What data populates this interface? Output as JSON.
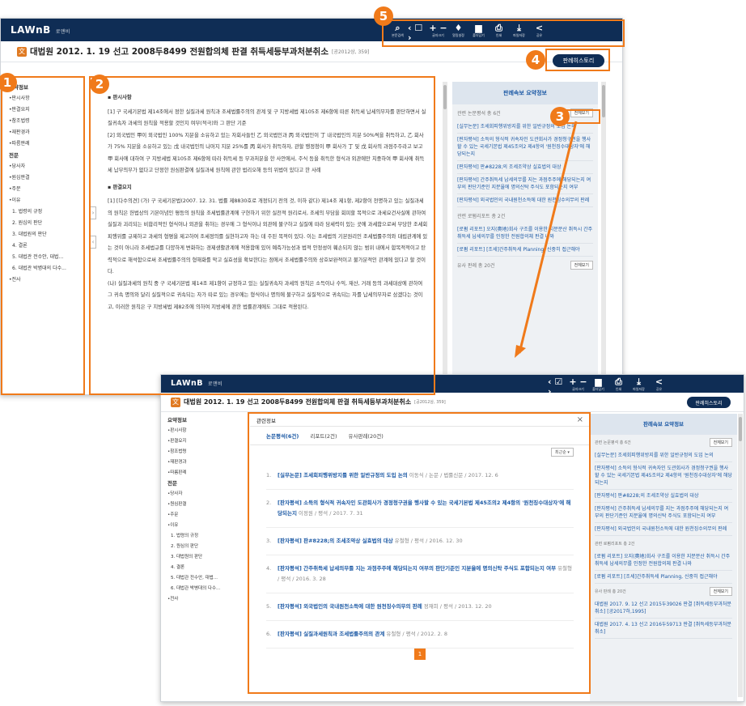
{
  "app": {
    "brand": "LAWnB",
    "user": "로앤비"
  },
  "title": {
    "main": "대법원 2012. 1. 19 선고 2008두8499 전원합의체 판결 취득세등부과처분취소",
    "citation": "[공2012상, 359]"
  },
  "history_button": "판례히스토리",
  "toolbar1": [
    {
      "icon": "search-icon",
      "glyph": "⌕",
      "label": "본문검색"
    },
    {
      "icon": "nav-arrows-icon",
      "glyph": "‹ ☐ ›",
      "label": "검색어"
    },
    {
      "icon": "zoom-icon",
      "glyph": "+ −",
      "label": "글자크기"
    },
    {
      "icon": "bell-icon",
      "glyph": "♦",
      "label": "알림설정"
    },
    {
      "icon": "folder-icon",
      "glyph": "▆",
      "label": "폴더담기"
    },
    {
      "icon": "print-icon",
      "glyph": "⎙",
      "label": "인쇄"
    },
    {
      "icon": "download-icon",
      "glyph": "⤓",
      "label": "파일저장"
    },
    {
      "icon": "share-icon",
      "glyph": "<",
      "label": "공유"
    }
  ],
  "toolbar2": [
    {
      "icon": "nav-arrows-icon",
      "glyph": "‹ ☑ ›",
      "label": "검색어"
    },
    {
      "icon": "zoom-icon",
      "glyph": "+ −",
      "label": "글자크기"
    },
    {
      "icon": "folder-icon",
      "glyph": "▆",
      "label": "폴더담기"
    },
    {
      "icon": "print-icon",
      "glyph": "⎙",
      "label": "인쇄"
    },
    {
      "icon": "download-icon",
      "glyph": "⤓",
      "label": "파일저장"
    },
    {
      "icon": "share-icon",
      "glyph": "<",
      "label": "공유"
    }
  ],
  "toc": {
    "summary_heading": "요약정보",
    "summary": [
      "•판시사항",
      "•판결요지",
      "•참조법령",
      "•재판경과",
      "•따름판례"
    ],
    "full_heading": "전문",
    "full": [
      "•당사자",
      "•원심판결",
      "•주문",
      "•이유"
    ],
    "reasons": [
      "1. 법령의 규정",
      "2. 원심의 판단",
      "3. 대법원의 판단",
      "4. 결론",
      "5. 대법관 전수안, 대법...",
      "6. 대법관 박병대의 다수..."
    ],
    "last": "•전사"
  },
  "content": {
    "sec1": "판시사항",
    "p1": "[1] 구 국세기본법 제14조에서 정한 실질과세 원칙과 조세법률주의의 관계 및 구 지방세법 제105조 제6항에 따른 취득세 납세의무자를 판단하면서 실질귀속자 과세의 원칙을 적용할 것인지 여부(적극)와 그 판단 기준",
    "p2": "[2] 외국법인 甲이 외국법인 100% 지분을 소유하고 있는 자회사들인 乙 외국법인과 丙 외국법인이 丁 내국법인의 지분 50%씩을 취득하고, 乙 회사가 75% 지분을 소유하고 있는 戊 내국법인의 나머지 지분 25%를 丙 회사가 취득하자, 관할 행정청이 甲 회사가 丁 및 戊 회사의 과점주주라고 보고 甲 회사에 대하여 구 지방세법 제105조 제6항에 따라 취득세 등 부과처분을 한 사안에서, 주식 등을 취득한 형식과 외관에만 치중하여 甲 회사에 취득세 납부의무가 없다고 단정한 원심판결에 실질과세 원칙에 관한 법리오해 등의 위법이 있다고 한 사례",
    "sec2": "판결요지",
    "p3": "[1] [다수의견] (가) 구 국세기본법(2007. 12. 31. 법률 제8830호로 개정되기 전의 것, 이하 같다) 제14조 제1항, 제2항이 천명하고 있는 실질과세의 원칙은 헌법상의 기본이념인 평등의 원칙을 조세법률관계에 구현하기 위한 실천적 원리로서, 조세의 부담을 회피할 목적으로 과세요건사실에 관하여 실질과 괴리되는 비합리적인 형식이나 외관을 취하는 경우에 그 형식이나 외관에 불구하고 실질에 따라 담세력이 있는 곳에 과세함으로써 부당한 조세회피행위를 규제하고 과세의 형평을 제고하여 조세정의를 실현하고자 하는 데 주된 목적이 있다. 이는 조세법의 기본원리인 조세법률주의와 대립관계에 있는 것이 아니라 조세법규를 다양하게 변화하는 경제생활관계에 적용함에 있어 예측가능성과 법적 안정성이 훼손되지 않는 범위 내에서 합목적적이고 탄력적으로 해석함으로써 조세법률주의의 형해화를 막고 실효성을 확보한다는 점에서 조세법률주의와 상호보완적이고 불가분적인 관계에 있다고 할 것이다.",
    "p4": "(나) 실질과세의 원칙 중 구 국세기본법 제14조 제1항이 규정하고 있는 실질귀속자 과세의 원칙은 소득이나 수익, 재산, 거래 등의 과세대상에 관하여 그 귀속 명의와 달리 실질적으로 귀속되는 자가 따로 있는 경우에는 형식이나 명의에 불구하고 실질적으로 귀속되는 자를 납세의무자로 삼겠다는 것이고, 이러한 원칙은 구 지방세법 제82조에 의하여 지방세에 관한 법률관계에도 그대로 적용된다."
  },
  "side": {
    "header": "판례속보 요약정보",
    "cited_label": "관련 논문평석 총 6건",
    "more": "전체보기",
    "cited": [
      "[실무논문] 조세회피행위방지를 위한 일반규정의 도입 논의",
      "[판자평석] 소득의 형식적 귀속자인 도관회사가 경정청구권을 행사할 수 있는 국세기본법 제45조의2 제4항의 '원천징수대상자'에 해당되는지",
      "[판자평석] 판#8228;의 조세조약상 실효법의 대상",
      "[판자평석] 간주취득세 납세의무를 지는 과점주주에 해당되는지 여부의 판단기준인 지분율에 명의신탁 주식도 포함되는지 여부",
      "[판자평석] 외국법인의 국내원천소득에 대한 원천징수의무의 판례"
    ],
    "report_label": "관련 로펌리포트 총 2건",
    "reports": [
      "[로펌 리포트] 오지(奧地)회사 구조를 이용한 지분분산 취득시 간주취득세 납세의무를 인정한 전원합의체 판결 나와",
      "[로펌 리포트] [조세]간주취득세 Planning, 신중히 접근해야"
    ],
    "similar_label": "유사 판례 총 20건",
    "similar": [
      "대법원 2017. 9. 12 선고 2015두39026 판결 [취득세등부과처분취소] [공2017하,1995]",
      "대법원 2017. 4. 13 선고 2016두59713 판결 [취득세등부과처분취소]"
    ]
  },
  "modal": {
    "title": "관련정보",
    "close": "×",
    "tabs": [
      "논문평석(6건)",
      "리포트(2건)",
      "유사판례(20건)"
    ],
    "sort": "최근순 ▾",
    "items": [
      {
        "n": "1.",
        "t": "[실무논문] 조세회피행위방지를 위한 일반규정의 도입 논의",
        "m": "이동식 / 논문 / 법률신문 / 2017. 12. 6"
      },
      {
        "n": "2.",
        "t": "[판자평석] 소득의 형식적 귀속자인 도관회사가 경정청구권을 행사할 수 있는 국세기본법 제45조의2 제4항의 '원천징수대상자'에 해당되는지",
        "m": "이정원 / 평석 / 2017. 7. 31"
      },
      {
        "n": "3.",
        "t": "[판자평석] 판#8228;의 조세조약상 실효법의 대상",
        "m": "유철형 / 평석 / 2016. 12. 30"
      },
      {
        "n": "4.",
        "t": "[판자평석] 간주취득세 납세의무를 지는 과점주주에 해당되는지 여부의 판단기준인 지분율에 명의신탁 주식도 포함되는지 여부",
        "m": "유철형 / 평석 / 2016. 3. 28"
      },
      {
        "n": "5.",
        "t": "[판자평석] 외국법인의 국내원천소득에 대한 원천징수의무의 판례",
        "m": "정재희 / 평석 / 2013. 12. 20"
      },
      {
        "n": "6.",
        "t": "[판자평석] 실질과세원칙과 조세법률주의의 관계",
        "m": "유철형 / 평석 / 2012. 2. 8"
      }
    ],
    "page": "1"
  },
  "badges": [
    "1",
    "2",
    "3",
    "4",
    "5"
  ],
  "colors": {
    "navy": "#0f2d55",
    "accent": "#f07a1a",
    "link": "#1d5aa5"
  }
}
